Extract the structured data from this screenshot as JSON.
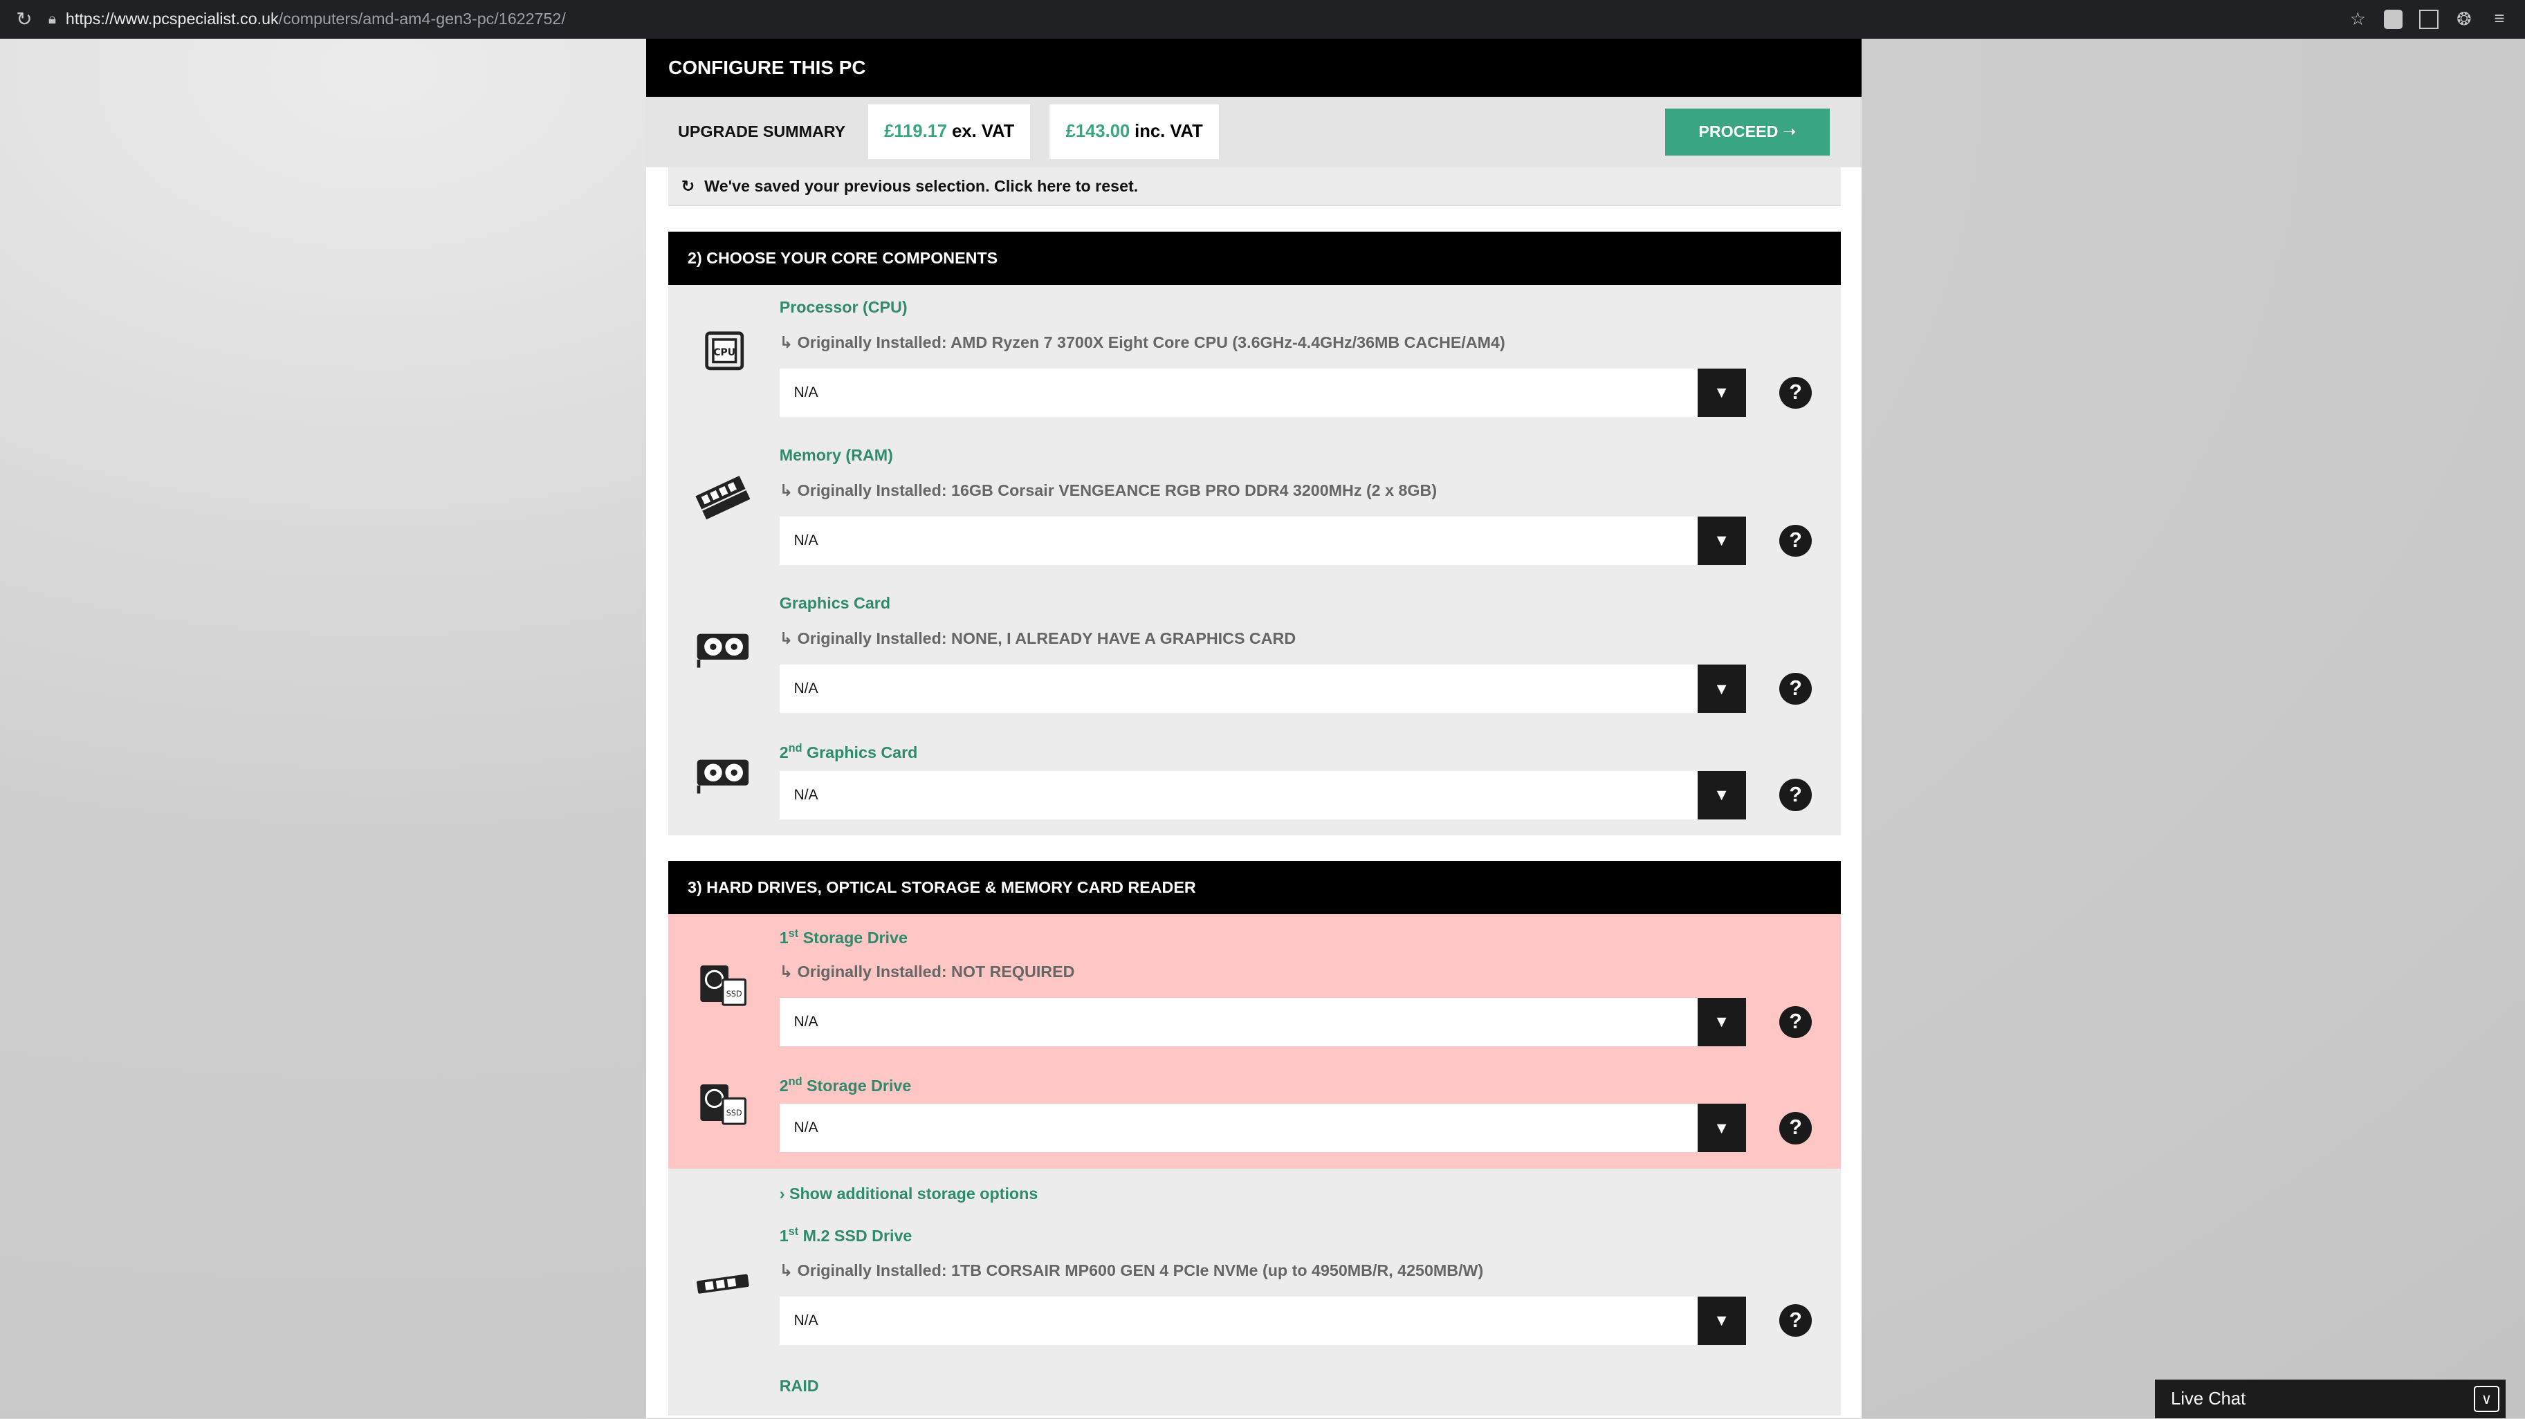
{
  "browser": {
    "url_host": "https://www.pcspecialist.co.uk",
    "url_path": "/computers/amd-am4-gen3-pc/1622752/"
  },
  "header": {
    "title": "CONFIGURE THIS PC"
  },
  "summary": {
    "label": "UPGRADE SUMMARY",
    "ex_vat_amount": "£119.17",
    "ex_vat_label": "ex. VAT",
    "inc_vat_amount": "£143.00",
    "inc_vat_label": "inc. VAT",
    "proceed_label": "PROCEED ➝"
  },
  "saved_notice": "We've saved your previous selection. Click here to reset.",
  "section2": {
    "title": "2) CHOOSE YOUR CORE COMPONENTS",
    "items": [
      {
        "title": "Processor (CPU)",
        "orig": "↳ Originally Installed: AMD Ryzen 7 3700X Eight Core CPU (3.6GHz-4.4GHz/36MB CACHE/AM4)",
        "value": "N/A",
        "icon": "cpu-icon"
      },
      {
        "title": "Memory (RAM)",
        "orig": "↳ Originally Installed: 16GB Corsair VENGEANCE RGB PRO DDR4 3200MHz (2 x 8GB)",
        "value": "N/A",
        "icon": "ram-icon"
      },
      {
        "title": "Graphics Card",
        "orig": "↳ Originally Installed: NONE, I ALREADY HAVE A GRAPHICS CARD",
        "value": "N/A",
        "icon": "graphics-card-icon"
      },
      {
        "title_sup": "nd",
        "title_pre": "2",
        "title_post": " Graphics Card",
        "value": "N/A",
        "icon": "graphics-card-icon"
      }
    ]
  },
  "section3": {
    "title": "3) HARD DRIVES, OPTICAL STORAGE & MEMORY CARD READER",
    "items": [
      {
        "title_pre": "1",
        "title_sup": "st",
        "title_post": " Storage Drive",
        "orig": "↳ Originally Installed: NOT REQUIRED",
        "value": "N/A",
        "icon": "storage-drive-icon"
      },
      {
        "title_pre": "2",
        "title_sup": "nd",
        "title_post": " Storage Drive",
        "value": "N/A",
        "icon": "storage-drive-icon"
      }
    ],
    "show_more": "Show additional storage options",
    "m2": {
      "title_pre": "1",
      "title_sup": "st",
      "title_post": " M.2 SSD Drive",
      "orig": "↳ Originally Installed: 1TB CORSAIR MP600 GEN 4 PCIe NVMe (up to 4950MB/R, 4250MB/W)",
      "value": "N/A",
      "icon": "m2-ssd-icon"
    },
    "raid_title": "RAID"
  },
  "live_chat": "Live Chat",
  "help_glyph": "?",
  "arrow_glyph": "▼"
}
